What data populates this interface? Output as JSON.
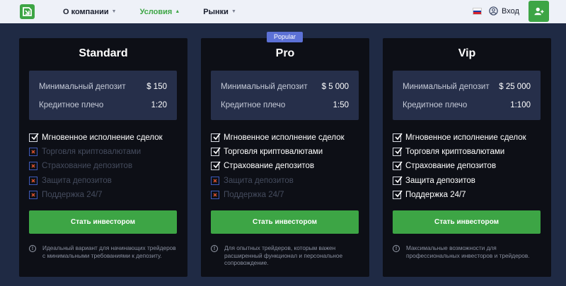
{
  "header": {
    "nav": [
      {
        "label": "О компании",
        "active": false
      },
      {
        "label": "Условия",
        "active": true
      },
      {
        "label": "Рынки",
        "active": false
      }
    ],
    "login_label": "Вход",
    "colors": {
      "accent": "#3da545",
      "header_bg": "#eef1f8"
    }
  },
  "plans": [
    {
      "title": "Standard",
      "deposit_label": "Минимальный депозит",
      "deposit_value": "$ 150",
      "leverage_label": "Кредитное плечо",
      "leverage_value": "1:20",
      "features": [
        {
          "label": "Мгновенное исполнение сделок",
          "enabled": true
        },
        {
          "label": "Торговля криптовалютами",
          "enabled": false
        },
        {
          "label": "Страхование депозитов",
          "enabled": false
        },
        {
          "label": "Защита депозитов",
          "enabled": false
        },
        {
          "label": "Поддержка 24/7",
          "enabled": false
        }
      ],
      "cta_label": "Стать инвестором",
      "note": "Идеальный вариант для начинающих трейдеров с минимальными требованиями к депозиту."
    },
    {
      "title": "Pro",
      "badge": "Popular",
      "deposit_label": "Минимальный депозит",
      "deposit_value": "$ 5 000",
      "leverage_label": "Кредитное плечо",
      "leverage_value": "1:50",
      "features": [
        {
          "label": "Мгновенное исполнение сделок",
          "enabled": true
        },
        {
          "label": "Торговля криптовалютами",
          "enabled": true
        },
        {
          "label": "Страхование депозитов",
          "enabled": true
        },
        {
          "label": "Защита депозитов",
          "enabled": false
        },
        {
          "label": "Поддержка 24/7",
          "enabled": false
        }
      ],
      "cta_label": "Стать инвестором",
      "note": "Для опытных трейдеров, которым важен расширенный функционал и персональное сопровождение."
    },
    {
      "title": "Vip",
      "deposit_label": "Минимальный депозит",
      "deposit_value": "$ 25 000",
      "leverage_label": "Кредитное плечо",
      "leverage_value": "1:100",
      "features": [
        {
          "label": "Мгновенное исполнение сделок",
          "enabled": true
        },
        {
          "label": "Торговля криптовалютами",
          "enabled": true
        },
        {
          "label": "Страхование депозитов",
          "enabled": true
        },
        {
          "label": "Защита депозитов",
          "enabled": true
        },
        {
          "label": "Поддержка 24/7",
          "enabled": true
        }
      ],
      "cta_label": "Стать инвестором",
      "note": "Максимальные возможности для профессиональных инвесторов и трейдеров."
    }
  ],
  "icons": {
    "logo": "logo-icon",
    "flag": "russia-flag-icon",
    "login": "user-circle-icon",
    "user_add": "user-add-icon",
    "feature_on": "checkbox-checked-icon",
    "feature_off": "checkbox-cross-icon",
    "note": "info-icon"
  }
}
